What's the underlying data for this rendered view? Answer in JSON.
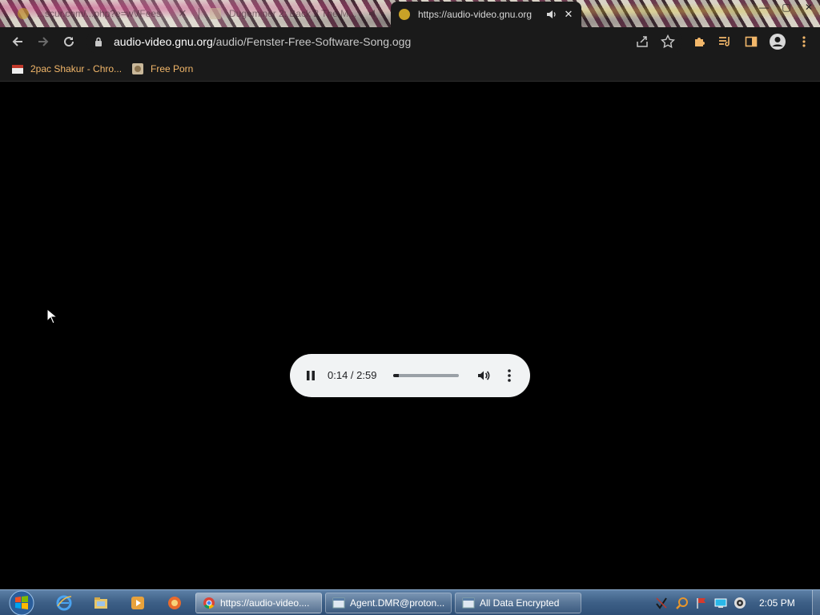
{
  "browser": {
    "tabs": [
      {
        "title": "...scur.com/...php?e=wVFees",
        "state": "inactive",
        "favicon_color": "#c9a227"
      },
      {
        "title": "Dugeminer 2: Back 2 The M...",
        "state": "inactive",
        "favicon_color": "#c9b89a"
      },
      {
        "title": "https://audio-video.gnu.org",
        "state": "active",
        "favicon_color": "#c9a227"
      }
    ],
    "close_glyph": "✕",
    "window_controls": {
      "minimize": "—",
      "maximize": "▢",
      "close": "✕"
    },
    "address_bar": {
      "host": "audio-video.gnu.org",
      "path": "/audio/Fenster-Free-Software-Song.ogg"
    },
    "bookmarks": [
      {
        "label": "2pac Shakur - Chro...",
        "icon": "bookmark-favicon-red"
      },
      {
        "label": "Free Porn",
        "icon": "bookmark-favicon-tan"
      }
    ]
  },
  "player": {
    "time": "0:14 / 2:59",
    "progress_fraction": 0.08,
    "state": "playing"
  },
  "taskbar": {
    "tasks": [
      {
        "label": "https://audio-video....",
        "icon": "chrome-icon",
        "active": true
      },
      {
        "label": "Agent.DMR@proton...",
        "icon": "window-icon",
        "active": false
      },
      {
        "label": "All Data Encrypted",
        "icon": "window-icon",
        "active": false
      }
    ],
    "clock": "2:05 PM"
  },
  "colors": {
    "accent_link": "#f2b76a",
    "player_bg": "#f1f3f4",
    "toolbar_bg": "#1a1a1a"
  }
}
